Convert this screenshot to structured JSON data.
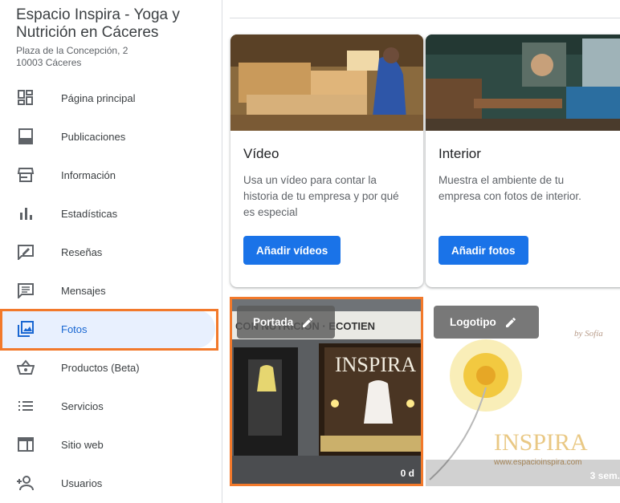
{
  "business": {
    "name": "Espacio Inspira - Yoga y Nutrición en Cáceres",
    "address_line1": "Plaza de la Concepción, 2",
    "address_line2": "10003 Cáceres"
  },
  "sidebar": {
    "items": [
      {
        "label": "Página principal",
        "icon": "dashboard-icon"
      },
      {
        "label": "Publicaciones",
        "icon": "posts-icon"
      },
      {
        "label": "Información",
        "icon": "storefront-icon"
      },
      {
        "label": "Estadísticas",
        "icon": "bar-chart-icon"
      },
      {
        "label": "Reseñas",
        "icon": "rate-review-icon"
      },
      {
        "label": "Mensajes",
        "icon": "message-icon"
      },
      {
        "label": "Fotos",
        "icon": "photo-library-icon",
        "active": true
      },
      {
        "label": "Productos (Beta)",
        "icon": "shopping-basket-icon"
      },
      {
        "label": "Servicios",
        "icon": "list-icon"
      },
      {
        "label": "Sitio web",
        "icon": "web-icon"
      },
      {
        "label": "Usuarios",
        "icon": "person-add-icon"
      }
    ]
  },
  "cards": [
    {
      "title": "Vídeo",
      "description": "Usa un vídeo para contar la historia de tu empresa y por qué es especial",
      "button": "Añadir vídeos"
    },
    {
      "title": "Interior",
      "description": "Muestra el ambiente de tu empresa con fotos de interior.",
      "button": "Añadir fotos"
    }
  ],
  "photos": [
    {
      "chip": "Portada",
      "age": "0 d",
      "sign_text": "INSPIRA",
      "banner_text": "CON NUTRICIÓN · ECOTIEN"
    },
    {
      "chip": "Logotipo",
      "age": "3 sem.",
      "logo_text": "INSPIRA",
      "logo_url": "www.espacioinspira.com",
      "tagline": "by Sofía"
    }
  ],
  "colors": {
    "accent": "#1a73e8",
    "highlight": "#f2792b",
    "active_bg": "#e8f0fe"
  }
}
